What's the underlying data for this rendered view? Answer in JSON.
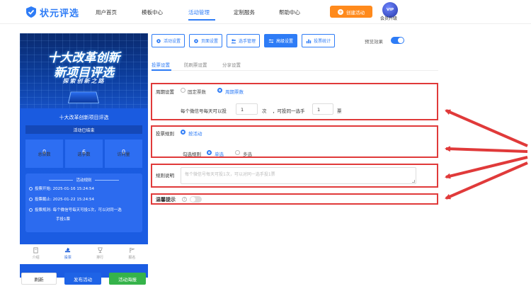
{
  "nav": {
    "logo_text": "状元评选",
    "items": [
      "用户首页",
      "模板中心",
      "活动管理",
      "定制服务",
      "帮助中心"
    ],
    "active_index": 2,
    "create_button": "创建活动",
    "vip_badge": "VIP",
    "upgrade_label": "会员升级"
  },
  "preview": {
    "banner_line1": "十大改革创新",
    "banner_line2": "新项目评选",
    "banner_sub": "探索创新之路",
    "title": "十大改革创新项目评选",
    "status": "活动已结束",
    "stats": [
      {
        "value": "0",
        "label": "总票数"
      },
      {
        "value": "6",
        "label": "选手数"
      },
      {
        "value": "0",
        "label": "访问量"
      }
    ],
    "rules_heading": "活动规则",
    "rules": [
      "投票开始: 2025-01-16 15:24:54",
      "投票截止: 2025-01-22 15:24:54",
      "投票规则: 每个微信号每天可投1次，可以对同一选",
      "手投1票"
    ],
    "tabs": [
      "介绍",
      "投票",
      "排行",
      "报名"
    ],
    "active_tab": 1
  },
  "actions": {
    "refresh": "刷新",
    "publish": "发布活动",
    "poster": "活动海报"
  },
  "toolbar": {
    "buttons": [
      "活动设置",
      "页面设置",
      "选手管理",
      "高级设置",
      "投票统计"
    ],
    "active_index": 3,
    "preview_effect_label": "预览效果"
  },
  "subtabs": {
    "items": [
      "投票设置",
      "防刷票设置",
      "分享设置"
    ],
    "active_index": 0
  },
  "settings": {
    "cycle": {
      "label": "周期设置",
      "options": [
        "固定票数",
        "周期票数"
      ],
      "selected": 1,
      "per_prefix": "每个微信号每天可以投",
      "per_value": "1",
      "per_unit": "次",
      "same_prefix": "，可投同一选手",
      "same_value": "1",
      "same_unit": "票"
    },
    "rule": {
      "label": "投票规则",
      "option": "按活动",
      "check_label": "勾选规则",
      "check_options": [
        "单选",
        "多选"
      ],
      "check_selected": 0
    },
    "desc": {
      "label": "规则说明",
      "placeholder": "每个微信号每天可投1次，可以对同一选手投1票"
    },
    "tip": {
      "label": "温馨提示",
      "help_glyph": "?"
    }
  },
  "colors": {
    "primary": "#2e7cf6",
    "highlight_border": "#e03a3a",
    "arrow": "#e03a3a",
    "create_button": "#ff8a1c",
    "poster_button": "#35b34a"
  }
}
